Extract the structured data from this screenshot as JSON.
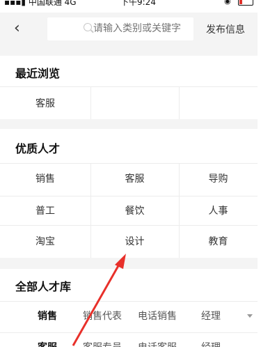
{
  "status_bar": {
    "carrier": "中国联通 4G",
    "time": "下午9:24"
  },
  "header": {
    "search_placeholder": "请输入类别或关键字",
    "publish_label": "发布信息"
  },
  "recent": {
    "title": "最近浏览",
    "items": [
      "客服"
    ]
  },
  "quality": {
    "title": "优质人才",
    "items": [
      "销售",
      "客服",
      "导购",
      "普工",
      "餐饮",
      "人事",
      "淘宝",
      "设计",
      "教育"
    ]
  },
  "all_talent": {
    "title": "全部人才库",
    "row1": [
      "销售",
      "销售代表",
      "电话销售",
      "经理"
    ],
    "row2": [
      "客服",
      "客服专员",
      "电话客服",
      "经理"
    ]
  },
  "colors": {
    "annotation_arrow": "#e8302a",
    "divider": "#ececec",
    "background_gray": "#f4f4f4"
  }
}
